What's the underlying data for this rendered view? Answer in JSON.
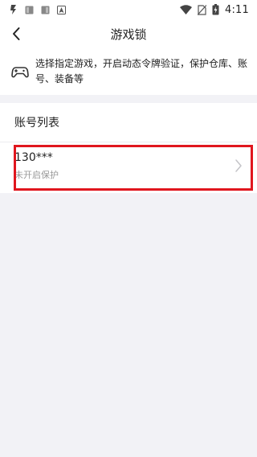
{
  "status_bar": {
    "time": "4:11",
    "icons": [
      "app-notification-icon",
      "notification-icon-2",
      "notification-icon-3",
      "navigation-arrow-icon",
      "wifi-icon",
      "no-sim-icon",
      "battery-charging-icon"
    ]
  },
  "nav": {
    "title": "游戏锁",
    "back_icon": "chevron-left-icon"
  },
  "banner": {
    "icon": "gamepad-icon",
    "line1": "选择指定游戏，开启动态令牌验证，保护仓库、账",
    "line2": "号、装备等"
  },
  "account_section": {
    "title": "账号列表",
    "accounts": [
      {
        "number": "130***",
        "status": "未开启保护"
      }
    ]
  },
  "colors": {
    "background": "#f2f2f6",
    "card": "#ffffff",
    "highlight": "#e0161e",
    "secondary_text": "#999999"
  }
}
